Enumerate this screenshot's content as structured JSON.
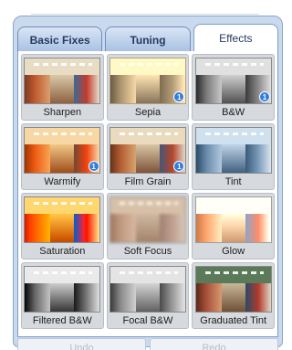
{
  "tabs": [
    {
      "label": "Basic Fixes",
      "active": false
    },
    {
      "label": "Tuning",
      "active": false
    },
    {
      "label": "Effects",
      "active": true
    }
  ],
  "effects": [
    {
      "label": "Sharpen",
      "style": "normal",
      "badge": ""
    },
    {
      "label": "Sepia",
      "style": "sepia",
      "badge": "1"
    },
    {
      "label": "B&W",
      "style": "bw",
      "badge": "1"
    },
    {
      "label": "Warmify",
      "style": "warm",
      "badge": "1"
    },
    {
      "label": "Film Grain",
      "style": "grain",
      "badge": "1"
    },
    {
      "label": "Tint",
      "style": "tint",
      "badge": ""
    },
    {
      "label": "Saturation",
      "style": "saturated",
      "badge": ""
    },
    {
      "label": "Soft Focus",
      "style": "soft",
      "badge": ""
    },
    {
      "label": "Glow",
      "style": "glow",
      "badge": ""
    },
    {
      "label": "Filtered B&W",
      "style": "filteredbw",
      "badge": ""
    },
    {
      "label": "Focal B&W",
      "style": "focalbw",
      "badge": ""
    },
    {
      "label": "Graduated Tint",
      "style": "gradtint",
      "badge": ""
    }
  ],
  "actions": {
    "undo_label": "Undo",
    "redo_label": "Redo"
  },
  "colors": {
    "panel_bg": "#c9d9ee",
    "tab_border": "#6e8db8",
    "badge": "#2f7de0",
    "cell_bg": "#d6d9dd"
  }
}
